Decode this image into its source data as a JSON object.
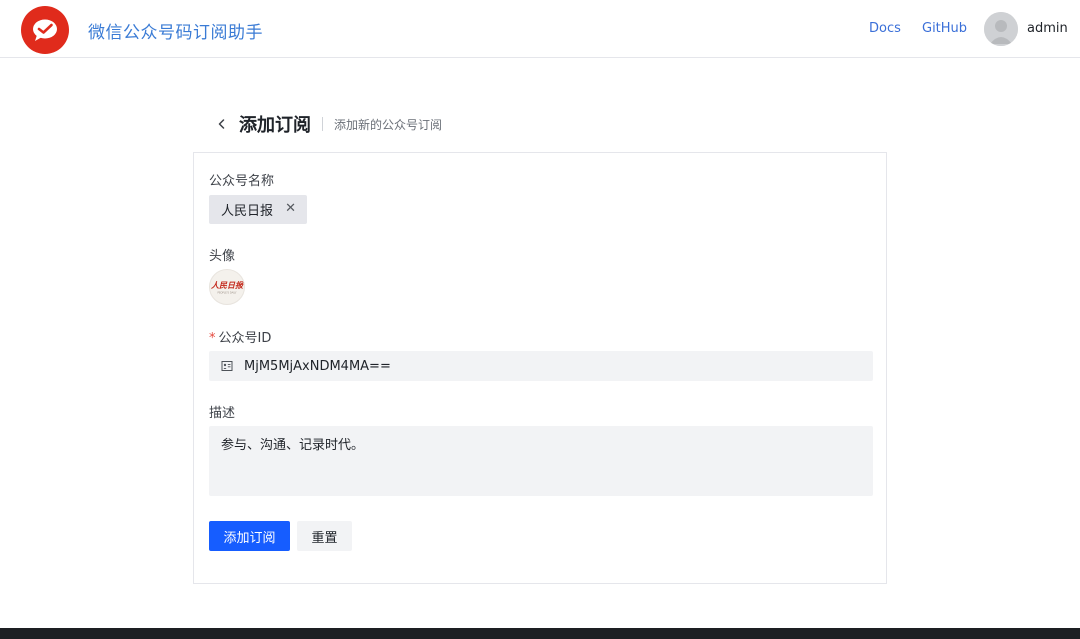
{
  "header": {
    "app_title": "微信公众号码订阅助手",
    "nav": {
      "docs": "Docs",
      "github": "GitHub"
    },
    "user": {
      "name": "admin"
    },
    "brand_color": "#e02b1c"
  },
  "page": {
    "title": "添加订阅",
    "subtitle": "添加新的公众号订阅"
  },
  "form": {
    "name_label": "公众号名称",
    "name_tag": "人民日报",
    "cover_label": "头像",
    "cover_logo_text": "人民日报",
    "cover_caption": "PEOPLE'S DAILY",
    "id_label": "公众号ID",
    "id_value": "MjM5MjAxNDM4MA==",
    "desc_label": "描述",
    "desc_value": "参与、沟通、记录时代。",
    "submit_label": "添加订阅",
    "reset_label": "重置"
  },
  "colors": {
    "primary": "#165dff",
    "link": "#3a6fd8",
    "required": "#e5483d"
  }
}
